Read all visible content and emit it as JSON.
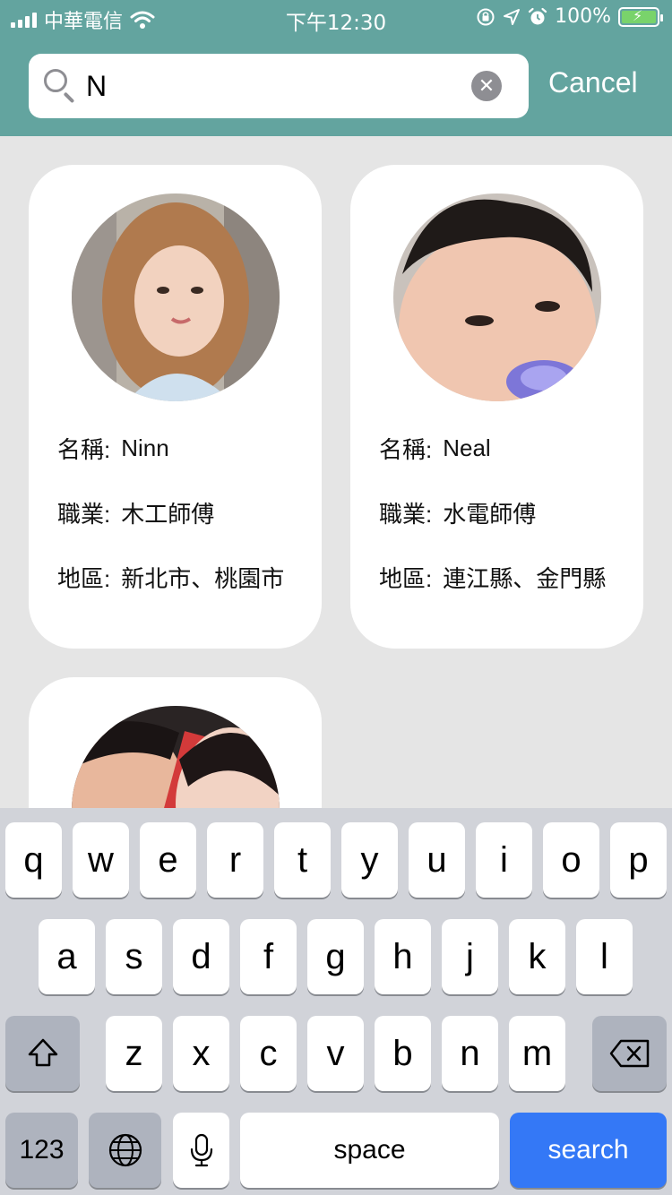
{
  "status_bar": {
    "carrier": "中華電信",
    "time": "下午12:30",
    "battery": "100%"
  },
  "search": {
    "query": "N",
    "cancel_label": "Cancel"
  },
  "cards": [
    {
      "name_label": "名稱:",
      "name": "Ninn",
      "job_label": "職業:",
      "job": "木工師傅",
      "area_label": "地區:",
      "area": "新北市、桃園市"
    },
    {
      "name_label": "名稱:",
      "name": "Neal",
      "job_label": "職業:",
      "job": "水電師傅",
      "area_label": "地區:",
      "area": "連江縣、金門縣"
    }
  ],
  "keyboard": {
    "row1": [
      "q",
      "w",
      "e",
      "r",
      "t",
      "y",
      "u",
      "i",
      "o",
      "p"
    ],
    "row2": [
      "a",
      "s",
      "d",
      "f",
      "g",
      "h",
      "j",
      "k",
      "l"
    ],
    "row3": [
      "z",
      "x",
      "c",
      "v",
      "b",
      "n",
      "m"
    ],
    "numbers_label": "123",
    "space_label": "space",
    "search_label": "search"
  },
  "colors": {
    "header": "#63a49f",
    "search_key": "#3478f6"
  }
}
